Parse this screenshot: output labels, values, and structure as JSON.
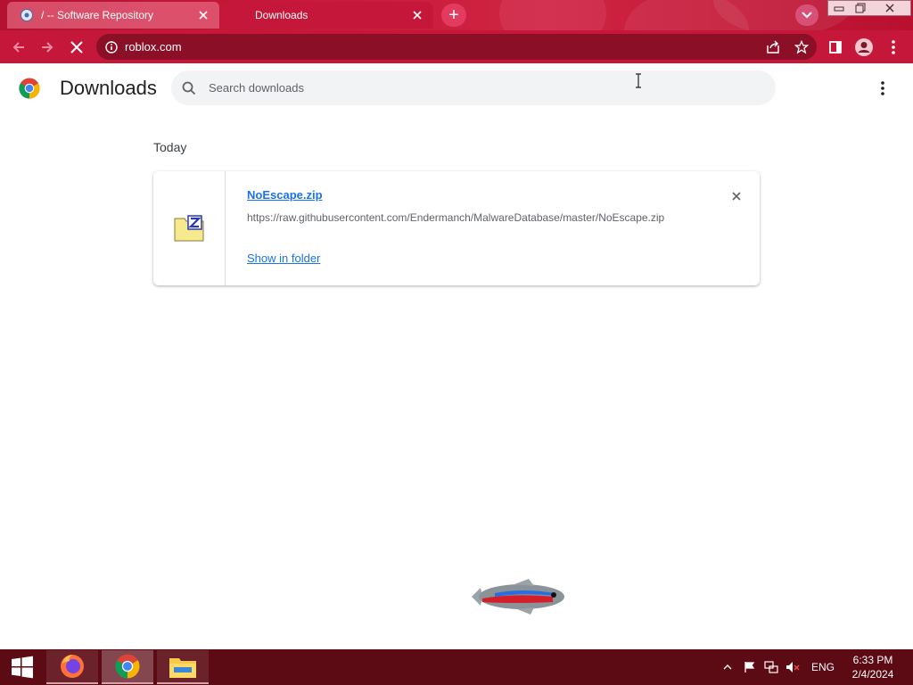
{
  "browser": {
    "tabs": [
      {
        "title": "/ -- Software Repository",
        "active": false,
        "favicon": "web-favicon"
      },
      {
        "title": "Downloads",
        "active": true,
        "favicon": "downloads-favicon"
      }
    ],
    "address": "roblox.com",
    "accent_color": "#c4173a"
  },
  "downloads": {
    "title": "Downloads",
    "search_placeholder": "Search downloads",
    "date_group": "Today",
    "items": [
      {
        "file_name": "NoEscape.zip",
        "url": "https://raw.githubusercontent.com/Endermanch/MalwareDatabase/master/NoEscape.zip",
        "action_label": "Show in folder",
        "icon": "zip-file-icon"
      }
    ]
  },
  "taskbar": {
    "apps": [
      "firefox-icon",
      "chrome-icon",
      "file-explorer-icon"
    ],
    "language": "ENG",
    "time": "6:33 PM",
    "date": "2/4/2024"
  }
}
